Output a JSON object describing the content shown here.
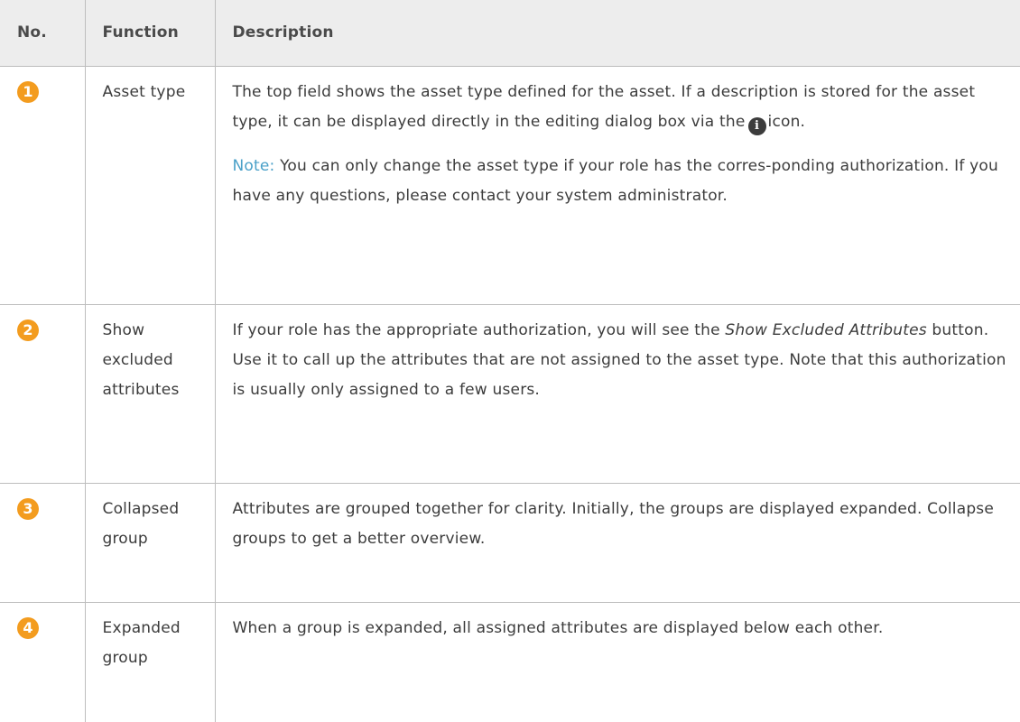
{
  "table": {
    "headers": {
      "no": "No.",
      "function": "Function",
      "description": "Description"
    },
    "rows": [
      {
        "badge": "1",
        "function": "Asset type",
        "desc_part1": "The top field shows the asset type defined for the asset. If a description is stored for the asset type, it can be displayed directly in the editing dialog box via the",
        "info_icon_glyph": "i",
        "desc_part2": "icon.",
        "note_label": "Note:",
        "note_text": "You can only change the asset type if your role has the corres-ponding authorization. If you have any questions, please contact your system administrator."
      },
      {
        "badge": "2",
        "function": "Show excluded attributes",
        "desc_part1": "If your role has the appropriate authorization, you will see the",
        "desc_emphasis": "Show Excluded Attributes",
        "desc_part2": "button. Use it to call up the attributes that are not assigned to the asset type. Note that this authorization is usually only assigned to a few users."
      },
      {
        "badge": "3",
        "function": "Collapsed group",
        "description": "Attributes are grouped together for clarity. Initially, the groups are displayed expanded. Collapse groups to get a better overview."
      },
      {
        "badge": "4",
        "function": "Expanded group",
        "description": "When a group is expanded, all assigned attributes are displayed below each other."
      }
    ]
  },
  "colors": {
    "badge": "#f39c1f",
    "note_label": "#4aa0c8",
    "header_bg": "#ededed",
    "border": "#bdbdbd"
  }
}
